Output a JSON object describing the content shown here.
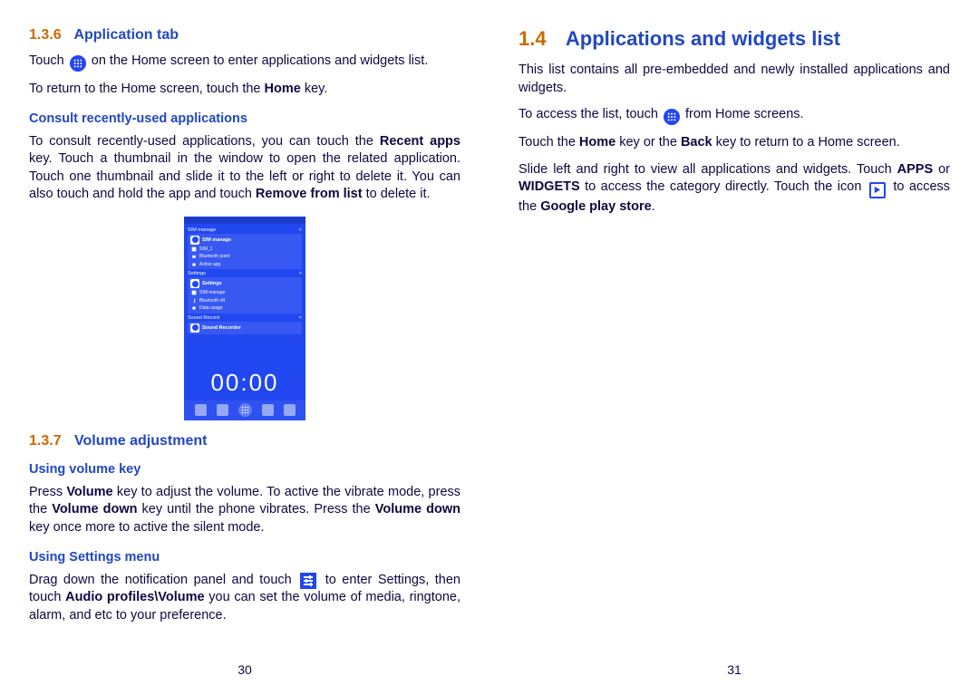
{
  "left": {
    "sec136": {
      "num": "1.3.6",
      "title": "Application tab"
    },
    "p1_a": "Touch",
    "p1_b": "on the Home screen to enter applications and widgets list.",
    "p2_a": "To return to the Home screen, touch the ",
    "p2_b": "Home",
    "p2_c": " key.",
    "h_consult": "Consult recently-used applications",
    "p3_a": "To consult recently-used applications, you can touch the ",
    "p3_b": "Recent apps",
    "p3_c": " key. Touch a thumbnail in the window to open the related application. Touch one thumbnail and slide it to the left or right to delete it. You can also touch and hold the app and touch ",
    "p3_d": "Remove from list",
    "p3_e": " to delete it.",
    "phone": {
      "section1": "SIM manage",
      "card1_title": "SIM manage",
      "card1_rows": [
        "SIM_1",
        "Bluetooth point",
        "Active app"
      ],
      "section2": "Settings",
      "card2_title": "Settings",
      "card2_rows": [
        "SIM manage",
        "Bluetooth off",
        "Data usage"
      ],
      "section3": "Sound Record",
      "card3_title": "Sound Recorder",
      "clock": "00:00"
    },
    "sec137": {
      "num": "1.3.7",
      "title": "Volume adjustment"
    },
    "h_vk": "Using volume key",
    "p4_a": "Press ",
    "p4_b": "Volume",
    "p4_c": " key to adjust the volume. To active the vibrate mode, press the ",
    "p4_d": "Volume down",
    "p4_e": " key until the phone vibrates. Press the ",
    "p4_f": "Volume down",
    "p4_g": " key once more to active the silent mode.",
    "h_sm": "Using Settings menu",
    "p5_a": "Drag down the notification panel and touch ",
    "p5_b": " to enter Settings, then touch ",
    "p5_c": "Audio profiles\\Volume",
    "p5_d": " you can set the volume of media, ringtone, alarm, and etc to your preference.",
    "page_no": "30"
  },
  "right": {
    "sec14": {
      "num": "1.4",
      "title": "Applications and widgets list"
    },
    "p1": "This list contains all pre-embedded and newly installed applications and widgets.",
    "p2_a": "To access the list, touch",
    "p2_b": "from Home screens.",
    "p3_a": "Touch the ",
    "p3_b": "Home",
    "p3_c": " key or the ",
    "p3_d": "Back",
    "p3_e": " key to return to a Home screen.",
    "p4_a": "Slide left and right to view all applications and widgets. Touch ",
    "p4_b": "APPS",
    "p4_c": " or ",
    "p4_d": "WIDGETS",
    "p4_e": " to access the category directly. Touch the icon",
    "p4_f": "to access the ",
    "p4_g": "Google play store",
    "p4_h": ".",
    "page_no": "31"
  }
}
